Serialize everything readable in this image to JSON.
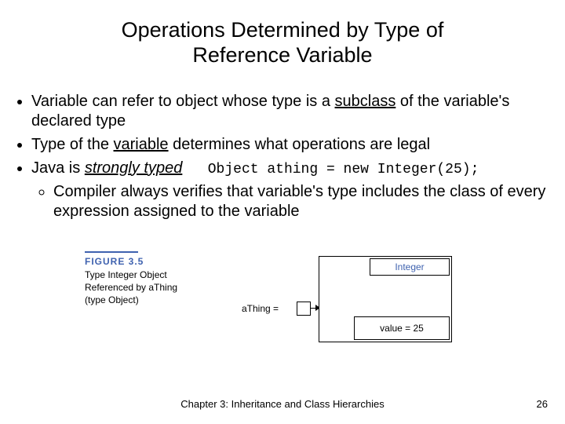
{
  "title_line1": "Operations Determined by Type of",
  "title_line2": "Reference Variable",
  "bullets": {
    "b1_pre": "Variable can refer to object whose type is a ",
    "b1_u": "subclass",
    "b1_post": " of the variable's declared type",
    "b2_pre": "Type of the ",
    "b2_u": "variable",
    "b2_post": " determines what operations are legal",
    "b3_pre": "Java is ",
    "b3_iu": "strongly typed",
    "b3_code": "   Object athing = new Integer(25);",
    "sub1": "Compiler always verifies that variable's type includes the class of every expression assigned to the variable"
  },
  "figure": {
    "label": "FIGURE 3.5",
    "caption_l1": "Type Integer Object",
    "caption_l2": "Referenced by aThing",
    "caption_l3": "(type Object)",
    "integer_label": "Integer",
    "value_label": "value = 25",
    "athing_label": "aThing ="
  },
  "footer": {
    "text": "Chapter 3: Inheritance and Class Hierarchies",
    "page": "26"
  }
}
